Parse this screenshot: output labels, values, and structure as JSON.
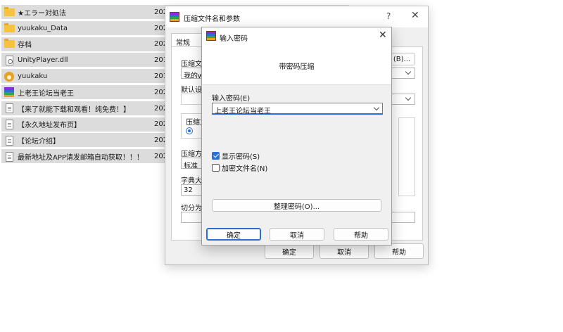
{
  "explorer": {
    "files": [
      {
        "name": "★エラー対処法",
        "date": "202",
        "icon": "folder-icon",
        "selected": true
      },
      {
        "name": "yuukaku_Data",
        "date": "202",
        "icon": "folder-icon",
        "selected": true
      },
      {
        "name": "存档",
        "date": "202",
        "icon": "folder-icon",
        "selected": true
      },
      {
        "name": "UnityPlayer.dll",
        "date": "201",
        "icon": "dll-file-icon",
        "selected": true
      },
      {
        "name": "yuukaku",
        "date": "201",
        "icon": "app-icon",
        "selected": true
      },
      {
        "name": "上老王论坛当老王",
        "date": "202",
        "icon": "winrar-archive-icon",
        "selected": true
      },
      {
        "name": "【来了就能下载和观看！纯免费！】",
        "date": "202",
        "icon": "text-file-icon",
        "selected": true
      },
      {
        "name": "【永久地址发布页】",
        "date": "202",
        "icon": "text-file-icon",
        "selected": true
      },
      {
        "name": "【论坛介绍】",
        "date": "202",
        "icon": "text-file-icon",
        "selected": true
      },
      {
        "name": "最新地址及APP请发邮箱自动获取！！！",
        "date": "202",
        "icon": "text-file-icon",
        "selected": true
      }
    ]
  },
  "archive_dialog": {
    "title": "压缩文件名和参数",
    "help_glyph": "?",
    "close_glyph": "✕",
    "tab_general": "常规",
    "archive_name_label": "压缩文",
    "archive_name_value": "我的w",
    "browse_button": "(B)...",
    "default_profile_label": "默认设",
    "archive_format_label": "压缩文",
    "compression_method_label": "压缩方",
    "compression_method_value": "标准",
    "dictionary_size_label": "字典大",
    "dictionary_size_value": "32",
    "split_volumes_label": "切分为",
    "ok_button": "确定",
    "cancel_button": "取消",
    "help_button": "帮助"
  },
  "password_dialog": {
    "title": "输入密码",
    "close_glyph": "✕",
    "header": "带密码压缩",
    "password_label": "输入密码(E)",
    "password_value": "上老王论坛当老王",
    "show_password_label": "显示密码(S)",
    "show_password_checked": true,
    "encrypt_names_label": "加密文件名(N)",
    "encrypt_names_checked": false,
    "manage_passwords_button": "整理密码(O)...",
    "ok_button": "确定",
    "cancel_button": "取消",
    "help_button": "帮助"
  },
  "colors": {
    "selection": "#dcdcdc",
    "accent": "#2a6fd6",
    "dialog_bg": "#f0f0f0"
  }
}
